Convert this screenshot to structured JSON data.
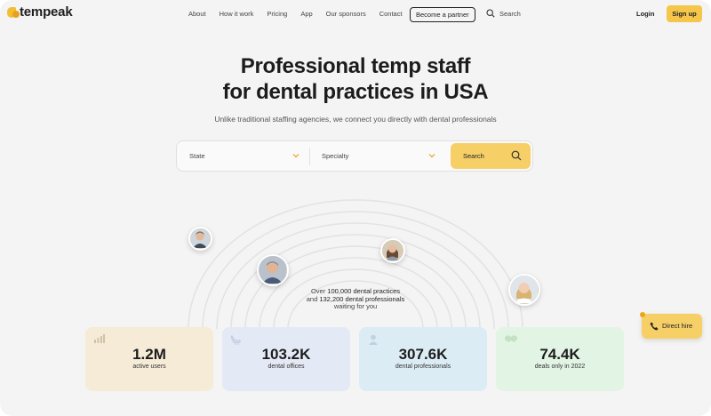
{
  "brand": {
    "name": "tempeak",
    "accent": "#f6c64a"
  },
  "nav": {
    "links": [
      "About",
      "How it work",
      "Pricing",
      "App",
      "Our sponsors",
      "Contact"
    ],
    "partner_button": "Become a partner",
    "search_label": "Search",
    "login_label": "Login",
    "signup_label": "Sign up"
  },
  "hero": {
    "title_line1": "Professional temp staff",
    "title_line2": "for dental practices in USA",
    "subtitle": "Unlike traditional staffing agencies, we connect you directly with dental professionals"
  },
  "search": {
    "state_placeholder": "State",
    "specialty_placeholder": "Specialty",
    "button_label": "Search"
  },
  "tagline": {
    "prefix": "Over ",
    "practices": "100,000 dental practices",
    "and": "and ",
    "professionals": "132,200 dental professionals",
    "suffix": "waiting for you"
  },
  "stats": [
    {
      "value": "1.2M",
      "label": "active users",
      "icon": "chart-icon",
      "color": "#f5ebd6"
    },
    {
      "value": "103.2K",
      "label": "dental offices",
      "icon": "dental-chair-icon",
      "color": "#e4e9f6"
    },
    {
      "value": "307.6K",
      "label": "dental professionals",
      "icon": "person-icon",
      "color": "#dcecf5"
    },
    {
      "value": "74.4K",
      "label": "deals only in 2022",
      "icon": "handshake-icon",
      "color": "#e2f4e3"
    }
  ],
  "direct_hire": {
    "label": "Direct hire",
    "icon": "phone-icon"
  }
}
